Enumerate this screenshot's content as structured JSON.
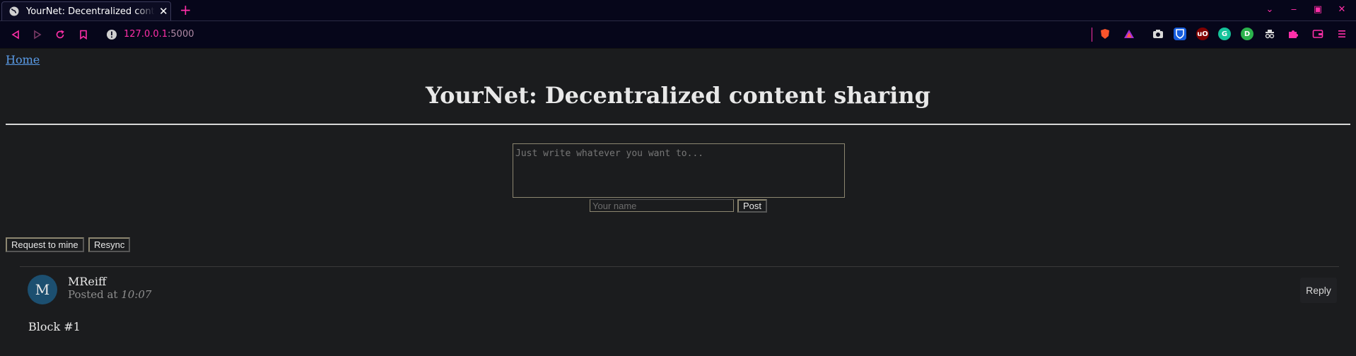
{
  "browser": {
    "tab_title": "YourNet: Decentralized content sharing",
    "new_tab_icon": "plus-icon",
    "url_host": "127.0.0.1",
    "url_port": ":5000",
    "accent_color": "#ff2fa8",
    "extensions": [
      "brave-shield-icon",
      "brave-rewards-icon",
      "camera-icon",
      "bitwarden-icon",
      "ublock-icon",
      "grammarly-icon",
      "extension-d-icon",
      "spy-icon",
      "puzzle-icon",
      "wallet-icon",
      "menu-icon"
    ]
  },
  "page": {
    "home_link": "Home",
    "title": "YourNet: Decentralized content sharing",
    "compose_placeholder": "Just write whatever you want to...",
    "name_placeholder": "Your name",
    "post_button": "Post",
    "request_button": "Request to mine",
    "resync_button": "Resync"
  },
  "posts": [
    {
      "avatar_letter": "M",
      "author": "MReiff",
      "posted_prefix": "Posted at",
      "time": "10:07",
      "reply_label": "Reply",
      "content": "Block #1",
      "avatar_color": "#1c4f70"
    }
  ]
}
